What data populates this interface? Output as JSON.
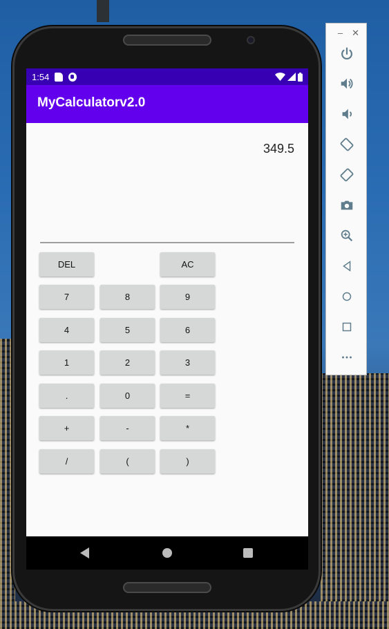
{
  "status_bar": {
    "time": "1:54"
  },
  "app_bar": {
    "title": "MyCalculatorv2.0"
  },
  "display": {
    "result": "349.5"
  },
  "keypad": {
    "del": "DEL",
    "ac": "AC",
    "k7": "7",
    "k8": "8",
    "k9": "9",
    "k4": "4",
    "k5": "5",
    "k6": "6",
    "k1": "1",
    "k2": "2",
    "k3": "3",
    "dot": ".",
    "k0": "0",
    "equals": "=",
    "plus": "+",
    "minus": "-",
    "multiply": "*",
    "divide": "/",
    "lparen": "(",
    "rparen": ")"
  },
  "emulator_toolbar": {
    "minimize": "–",
    "close": "✕",
    "icons": [
      "power-icon",
      "volume-up-icon",
      "volume-down-icon",
      "rotate-left-icon",
      "rotate-right-icon",
      "camera-icon",
      "zoom-icon",
      "back-icon",
      "home-icon",
      "overview-icon",
      "more-icon"
    ]
  },
  "colors": {
    "status_bar": "#3700b3",
    "app_bar": "#6200ee",
    "button": "#d6d7d7",
    "icon": "#5f7d8c"
  }
}
